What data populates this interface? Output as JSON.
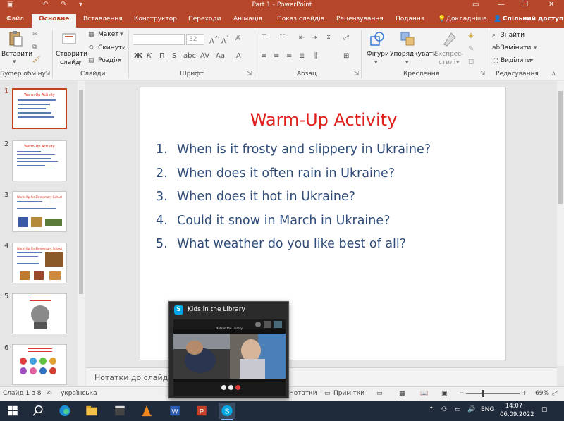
{
  "window": {
    "title": "Part 1 - PowerPoint"
  },
  "tabs": [
    "Файл",
    "Основне",
    "Вставлення",
    "Конструктор",
    "Переходи",
    "Анімація",
    "Показ слайдів",
    "Рецензування",
    "Подання",
    "Докладніше",
    "Спільний доступ"
  ],
  "ribbon": {
    "clipboard": {
      "paste": "Вставити",
      "label": "Буфер обміну"
    },
    "slides": {
      "new_slide_1": "Створити",
      "new_slide_2": "слайд",
      "layout": "Макет",
      "reset": "Скинути",
      "section": "Розділ",
      "label": "Слайди"
    },
    "font": {
      "size": "32",
      "label": "Шрифт"
    },
    "paragraph": {
      "label": "Абзац"
    },
    "drawing": {
      "shapes": "Фігури",
      "arrange": "Упорядкувати",
      "quick_styles_1": "Експрес-",
      "quick_styles_2": "стилі",
      "label": "Креслення"
    },
    "editing": {
      "find": "Знайти",
      "replace": "Замінити",
      "select": "Виділити",
      "label": "Редагування"
    }
  },
  "thumbnails": [
    {
      "num": "1",
      "title": "Warm-Up Activity",
      "selected": true
    },
    {
      "num": "2",
      "title": "Warm-Up Activity",
      "selected": false
    },
    {
      "num": "3",
      "title": "Warm-Up for Elementary School",
      "selected": false
    },
    {
      "num": "4",
      "title": "Warm-Up for Elementary School",
      "selected": false
    },
    {
      "num": "5",
      "title": "",
      "selected": false
    },
    {
      "num": "6",
      "title": "",
      "selected": false
    }
  ],
  "slide": {
    "title": "Warm-Up Activity",
    "items": [
      {
        "n": "1.",
        "text": "When is it frosty and slippery in Ukraine?"
      },
      {
        "n": "2.",
        "text": "When does it often rain in Ukraine?"
      },
      {
        "n": "3.",
        "text": "When does it hot in Ukraine?"
      },
      {
        "n": "4.",
        "text": "Could it snow in March in Ukraine?"
      },
      {
        "n": "5.",
        "text": "What weather do you like best of all?"
      }
    ]
  },
  "notes": {
    "placeholder": "Нотатки до слайда"
  },
  "status": {
    "slide_info": "Слайд 1 з 8",
    "language": "українська",
    "notes_btn": "Нотатки",
    "comments_btn": "Примітки",
    "zoom": "69%"
  },
  "popup": {
    "title": "Kids in the Library",
    "preview_title": "Kids in the Library"
  },
  "taskbar": {
    "lang": "ENG",
    "time": "14:07",
    "date": "06.09.2022"
  },
  "colors": {
    "accent": "#b7472a",
    "slide_title": "#e0201b",
    "slide_text": "#2f4c7a"
  }
}
